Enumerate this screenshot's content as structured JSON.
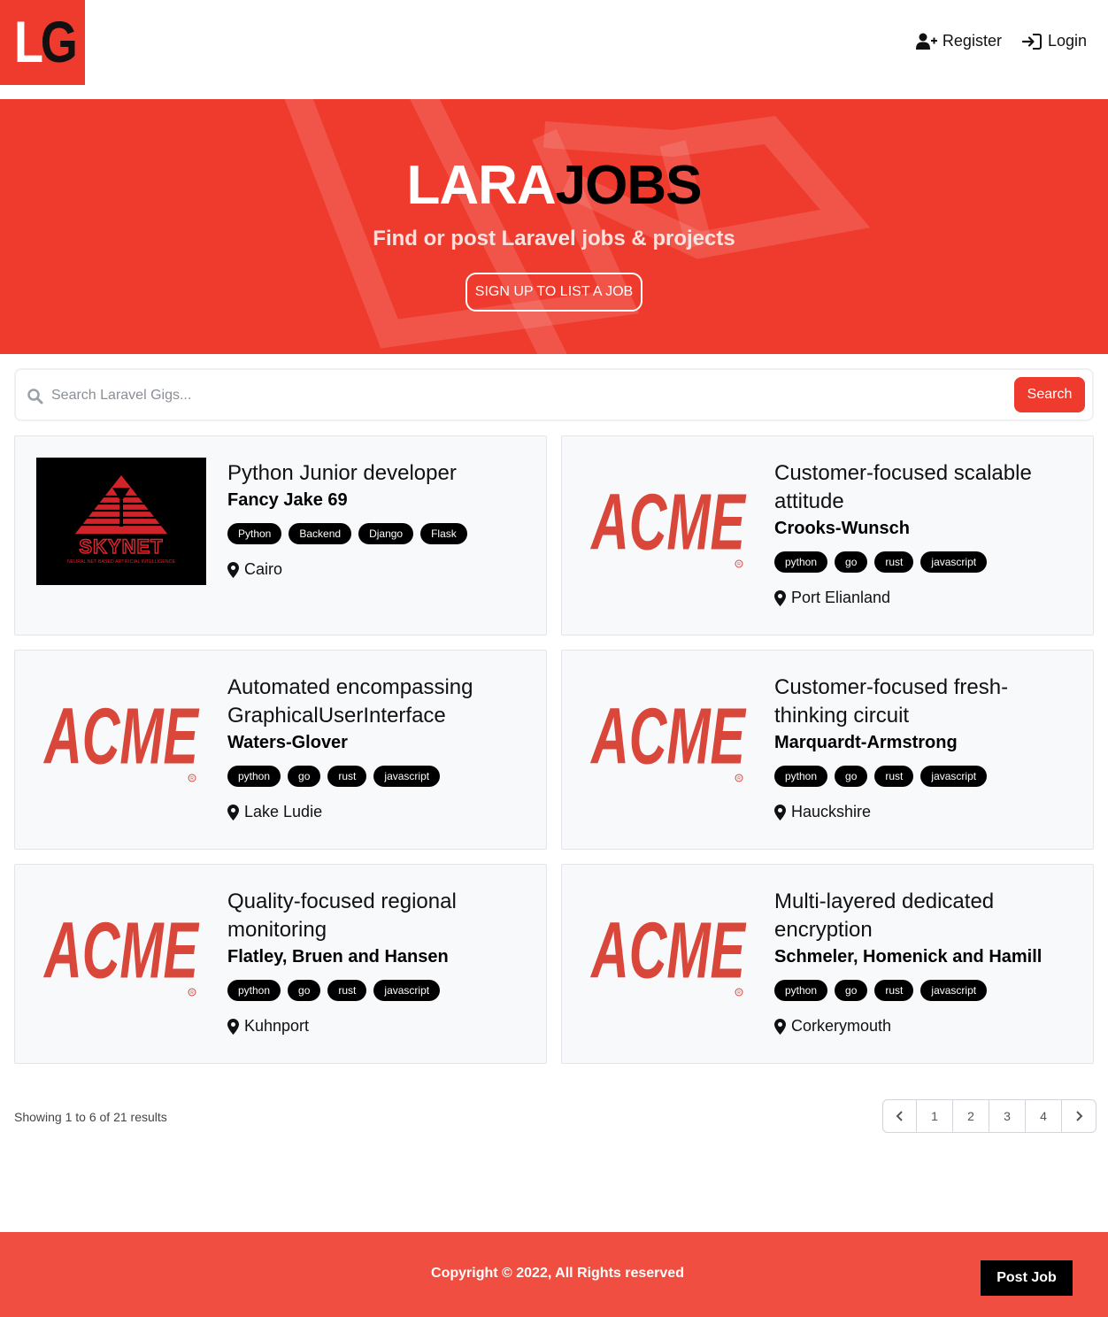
{
  "nav": {
    "logo": {
      "left": "L",
      "right": "G"
    },
    "register_label": "Register",
    "login_label": "Login"
  },
  "hero": {
    "title_part1": "LARA",
    "title_part2": "JOBS",
    "subtitle": "Find or post Laravel jobs & projects",
    "cta_label": "Sign up to list a job"
  },
  "search": {
    "placeholder": "Search Laravel Gigs...",
    "button_label": "Search"
  },
  "listings": [
    {
      "logo": "skynet-logo",
      "logo_text": "SKYNET",
      "logo_subtext": "NEURAL NET-BASED ARTIFICIAL INTELLIGENCE",
      "title": "Python Junior developer",
      "company": "Fancy Jake 69",
      "tags": [
        "Python",
        "Backend",
        "Django",
        "Flask"
      ],
      "location": "Cairo"
    },
    {
      "logo": "acme-logo",
      "logo_text": "ACME",
      "title": "Customer-focused scalable attitude",
      "company": "Crooks-Wunsch",
      "tags": [
        "python",
        "go",
        "rust",
        "javascript"
      ],
      "location": "Port Elianland"
    },
    {
      "logo": "acme-logo",
      "logo_text": "ACME",
      "title": "Automated encompassing GraphicalUserInterface",
      "company": "Waters-Glover",
      "tags": [
        "python",
        "go",
        "rust",
        "javascript"
      ],
      "location": "Lake Ludie"
    },
    {
      "logo": "acme-logo",
      "logo_text": "ACME",
      "title": "Customer-focused fresh-thinking circuit",
      "company": "Marquardt-Armstrong",
      "tags": [
        "python",
        "go",
        "rust",
        "javascript"
      ],
      "location": "Hauckshire"
    },
    {
      "logo": "acme-logo",
      "logo_text": "ACME",
      "title": "Quality-focused regional monitoring",
      "company": "Flatley, Bruen and Hansen",
      "tags": [
        "python",
        "go",
        "rust",
        "javascript"
      ],
      "location": "Kuhnport"
    },
    {
      "logo": "acme-logo",
      "logo_text": "ACME",
      "title": "Multi-layered dedicated encryption",
      "company": "Schmeler, Homenick and Hamill",
      "tags": [
        "python",
        "go",
        "rust",
        "javascript"
      ],
      "location": "Corkerymouth"
    }
  ],
  "pagination": {
    "summary": "Showing 1 to 6 of 21 results",
    "pages": [
      "1",
      "2",
      "3",
      "4"
    ]
  },
  "footer": {
    "copyright": "Copyright © 2022, All Rights reserved",
    "post_job_label": "Post Job"
  },
  "colors": {
    "brand": "#ef3b2d",
    "footer": "#ef4e40",
    "acme": "#d9463a"
  }
}
